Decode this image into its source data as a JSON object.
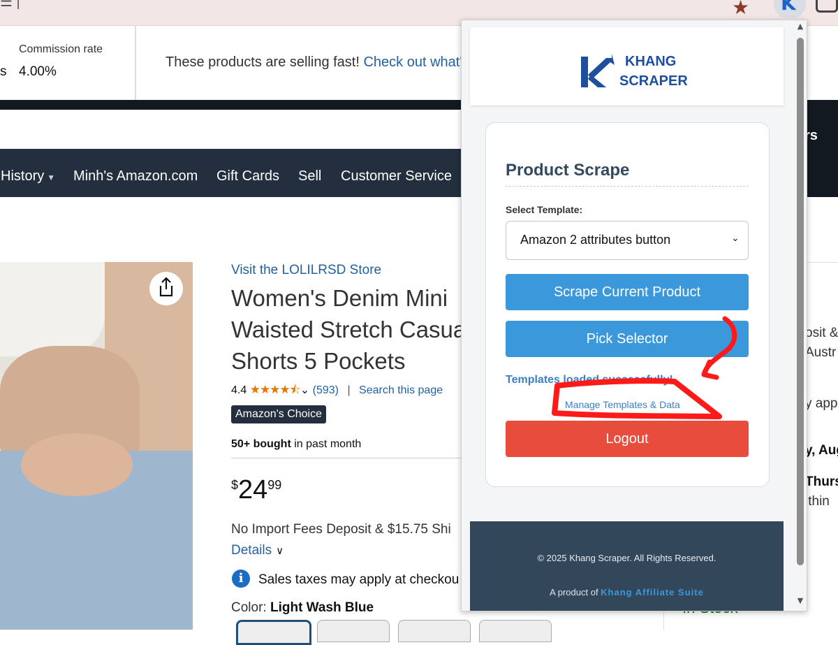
{
  "browser": {
    "url_tail": "☰ |",
    "star_icon": "bookmark-star-icon",
    "extension_icon": "khang-scraper-extension-icon"
  },
  "associates_bar": {
    "left_fragment": "s",
    "commission_label": "Commission rate",
    "commission_value": "4.00%",
    "selling_text": "These products are selling fast! ",
    "selling_link": "Check out what'"
  },
  "nav": {
    "items": [
      "History",
      "Minh's Amazon.com",
      "Gift Cards",
      "Sell",
      "Customer Service"
    ],
    "right_fragment": "rs"
  },
  "product": {
    "store_link": "Visit the LOLILRSD Store",
    "title_lines": [
      "Women's Denim Mini",
      "Waisted Stretch Casua",
      "Shorts 5 Pockets"
    ],
    "rating": "4.4",
    "stars": "★★★★⯪",
    "rating_count": "(593)",
    "separator": "|",
    "search_page": "Search this page",
    "badge": "Amazon's Choice",
    "bought_bold": "50+ bought",
    "bought_rest": " in past month",
    "price_symbol": "$",
    "price_whole": "24",
    "price_fraction": "99",
    "import_fees": "No Import Fees Deposit & $15.75 Shi",
    "details": "Details",
    "sales_tax": "Sales taxes may apply at checkou",
    "color_label": "Color: ",
    "color_value": "Light Wash Blue"
  },
  "right_column": {
    "frag_1": "osit &",
    "frag_2": "Austr",
    "frag_3": "y appl",
    "frag_4": "y, Aug",
    "frag_5": "Thurs",
    "frag_6": "ithin",
    "in_stock": "In Stock"
  },
  "popup": {
    "logo_line1": "KHANG",
    "logo_line2": "SCRAPER",
    "card_title": "Product Scrape",
    "select_label": "Select Template:",
    "selected_template": "Amazon 2 attributes button",
    "scrape_button": "Scrape Current Product",
    "pick_button": "Pick Selector",
    "status": "Templates loaded successfully!",
    "manage_link": "Manage Templates & Data",
    "logout_button": "Logout",
    "copyright": "© 2025 Khang Scraper. All Rights Reserved.",
    "product_of": "A product of ",
    "suite_name": "Khang Affiliate Suite",
    "colors": {
      "primary_button": "#3b98db",
      "logout_button": "#e74c3c",
      "footer": "#33475b",
      "annotation": "#ff0000"
    }
  }
}
